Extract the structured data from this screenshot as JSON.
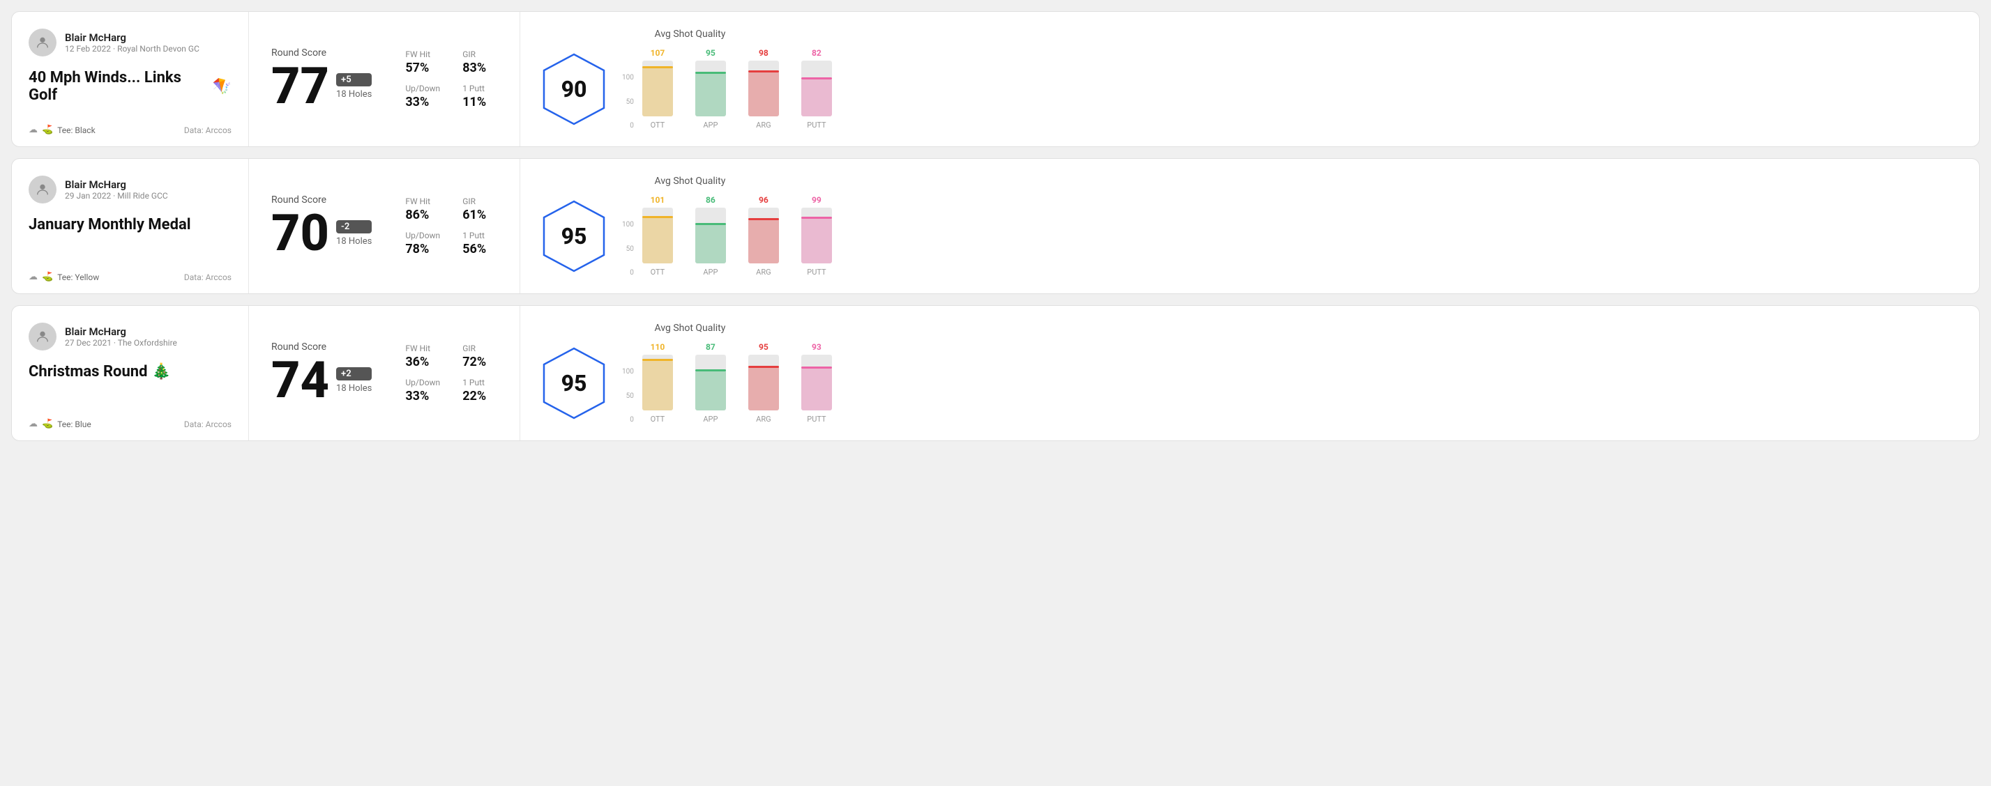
{
  "rounds": [
    {
      "id": "round1",
      "user": {
        "name": "Blair McHarg",
        "date": "12 Feb 2022 · Royal North Devon GC"
      },
      "title": "40 Mph Winds... Links Golf",
      "title_emoji": "🪁",
      "tee": "Black",
      "data_source": "Data: Arccos",
      "score": {
        "label": "Round Score",
        "number": "77",
        "badge": "+5",
        "holes": "18 Holes"
      },
      "stats": {
        "fw_hit_label": "FW Hit",
        "fw_hit_value": "57%",
        "gir_label": "GIR",
        "gir_value": "83%",
        "updown_label": "Up/Down",
        "updown_value": "33%",
        "oneputt_label": "1 Putt",
        "oneputt_value": "11%"
      },
      "shot_quality": {
        "label": "Avg Shot Quality",
        "score": "90"
      },
      "chart": {
        "bars": [
          {
            "label": "OTT",
            "value": 107,
            "color": "#f0b429",
            "bar_color": "#f0b429"
          },
          {
            "label": "APP",
            "value": 95,
            "color": "#48bb78",
            "bar_color": "#48bb78"
          },
          {
            "label": "ARG",
            "value": 98,
            "color": "#e53e3e",
            "bar_color": "#e53e3e"
          },
          {
            "label": "PUTT",
            "value": 82,
            "color": "#ed64a6",
            "bar_color": "#ed64a6"
          }
        ],
        "max": 120
      }
    },
    {
      "id": "round2",
      "user": {
        "name": "Blair McHarg",
        "date": "29 Jan 2022 · Mill Ride GCC"
      },
      "title": "January Monthly Medal",
      "title_emoji": "",
      "tee": "Yellow",
      "data_source": "Data: Arccos",
      "score": {
        "label": "Round Score",
        "number": "70",
        "badge": "-2",
        "holes": "18 Holes"
      },
      "stats": {
        "fw_hit_label": "FW Hit",
        "fw_hit_value": "86%",
        "gir_label": "GIR",
        "gir_value": "61%",
        "updown_label": "Up/Down",
        "updown_value": "78%",
        "oneputt_label": "1 Putt",
        "oneputt_value": "56%"
      },
      "shot_quality": {
        "label": "Avg Shot Quality",
        "score": "95"
      },
      "chart": {
        "bars": [
          {
            "label": "OTT",
            "value": 101,
            "color": "#f0b429",
            "bar_color": "#f0b429"
          },
          {
            "label": "APP",
            "value": 86,
            "color": "#48bb78",
            "bar_color": "#48bb78"
          },
          {
            "label": "ARG",
            "value": 96,
            "color": "#e53e3e",
            "bar_color": "#e53e3e"
          },
          {
            "label": "PUTT",
            "value": 99,
            "color": "#ed64a6",
            "bar_color": "#ed64a6"
          }
        ],
        "max": 120
      }
    },
    {
      "id": "round3",
      "user": {
        "name": "Blair McHarg",
        "date": "27 Dec 2021 · The Oxfordshire"
      },
      "title": "Christmas Round",
      "title_emoji": "🎄",
      "tee": "Blue",
      "data_source": "Data: Arccos",
      "score": {
        "label": "Round Score",
        "number": "74",
        "badge": "+2",
        "holes": "18 Holes"
      },
      "stats": {
        "fw_hit_label": "FW Hit",
        "fw_hit_value": "36%",
        "gir_label": "GIR",
        "gir_value": "72%",
        "updown_label": "Up/Down",
        "updown_value": "33%",
        "oneputt_label": "1 Putt",
        "oneputt_value": "22%"
      },
      "shot_quality": {
        "label": "Avg Shot Quality",
        "score": "95"
      },
      "chart": {
        "bars": [
          {
            "label": "OTT",
            "value": 110,
            "color": "#f0b429",
            "bar_color": "#f0b429"
          },
          {
            "label": "APP",
            "value": 87,
            "color": "#48bb78",
            "bar_color": "#48bb78"
          },
          {
            "label": "ARG",
            "value": 95,
            "color": "#e53e3e",
            "bar_color": "#e53e3e"
          },
          {
            "label": "PUTT",
            "value": 93,
            "color": "#ed64a6",
            "bar_color": "#ed64a6"
          }
        ],
        "max": 120
      }
    }
  ],
  "ui": {
    "y_axis_labels": [
      "100",
      "50",
      "0"
    ],
    "tee_icon": "☁",
    "bag_icon": "🏌"
  }
}
